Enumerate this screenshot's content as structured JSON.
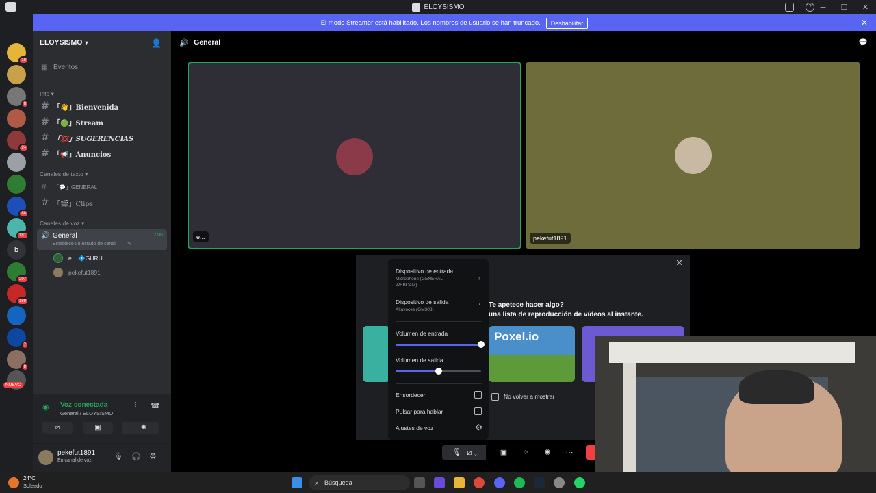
{
  "window": {
    "title": "ELOYSISMO"
  },
  "banner": {
    "text": "El modo Streamer está habilitado. Los nombres de usuario se han truncado.",
    "button": "Deshabilitar"
  },
  "guild_badges": [
    "18",
    "8",
    "24",
    "88",
    "181",
    "297",
    "188",
    "7",
    "8"
  ],
  "guild_new": "NUEVO",
  "sidebar": {
    "server_name": "ELOYSISMO",
    "events": "Eventos",
    "cat_info": "Info",
    "info_channels": [
      "「👋」Bienvenida",
      "「🟢」Stream",
      "「💢」SUGERENCIAS",
      "「📢」Anuncios"
    ],
    "cat_text": "Canales de texto",
    "text_channels": [
      "「💬」GENERAL",
      "「🎬」Clips"
    ],
    "cat_voice": "Canales de voz",
    "voice_channel": "General",
    "voice_time": "2:06",
    "voice_status": "Establece un estado de canal",
    "voice_users": [
      "e... 💠GURU",
      "pekefut1891"
    ]
  },
  "voice_panel": {
    "status": "Voz conectada",
    "location": "General / ELOYSISMO"
  },
  "user_panel": {
    "name": "pekefut1891",
    "status": "En canal de voz"
  },
  "main": {
    "channel": "General",
    "tiles": [
      {
        "name": "e...",
        "bg": "#2f2e37",
        "avatar": "#8a3a48"
      },
      {
        "name": "pekefut1891",
        "bg": "#6f6c3b",
        "avatar": "#c9b9a3"
      }
    ]
  },
  "activity": {
    "line1": "Te apetece hacer algo?",
    "line2": "una lista de reproducción de vídeos al instante.",
    "game": "Poxel.io",
    "dont_show": "No volver a mostrar"
  },
  "audio_popup": {
    "input_device_label": "Dispositivo de entrada",
    "input_device_value": "Microphone (GENERAL WEBCAM)",
    "output_device_label": "Dispositivo de salida",
    "output_device_value": "Altavoces (GM303)",
    "input_volume_label": "Volumen de entrada",
    "input_volume": 1.0,
    "output_volume_label": "Volumen de salida",
    "output_volume": 0.5,
    "deafen_label": "Ensordecer",
    "ptt_label": "Pulsar para hablar",
    "voice_settings_label": "Ajustes de voz"
  },
  "taskbar": {
    "temperature": "24°C",
    "weather": "Soleado",
    "search_placeholder": "Búsqueda"
  },
  "colors": {
    "accent": "#5865f2",
    "green": "#23a55a",
    "red": "#f23f43"
  }
}
